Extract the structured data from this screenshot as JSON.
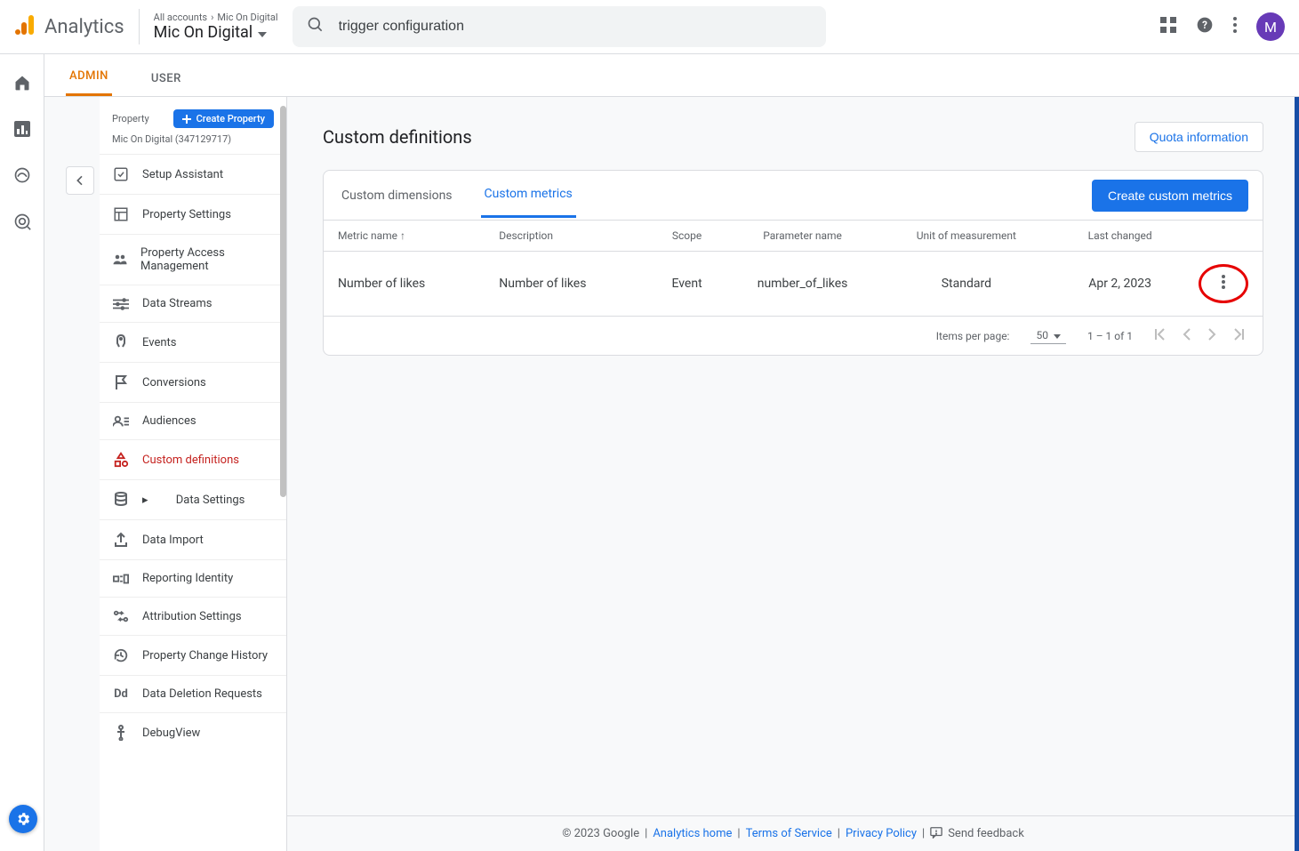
{
  "header": {
    "product": "Analytics",
    "breadcrumb_a": "All accounts",
    "breadcrumb_b": "Mic On Digital",
    "property": "Mic On Digital",
    "search_value": "trigger configuration",
    "avatar_letter": "M"
  },
  "subtabs": {
    "admin": "ADMIN",
    "user": "USER"
  },
  "sidebar": {
    "section_label": "Property",
    "create_label": "Create Property",
    "property_line": "Mic On Digital (347129717)",
    "items": [
      {
        "label": "Setup Assistant"
      },
      {
        "label": "Property Settings"
      },
      {
        "label": "Property Access Management"
      },
      {
        "label": "Data Streams"
      },
      {
        "label": "Events"
      },
      {
        "label": "Conversions"
      },
      {
        "label": "Audiences"
      },
      {
        "label": "Custom definitions"
      },
      {
        "label": "Data Settings"
      },
      {
        "label": "Data Import"
      },
      {
        "label": "Reporting Identity"
      },
      {
        "label": "Attribution Settings"
      },
      {
        "label": "Property Change History"
      },
      {
        "label": "Data Deletion Requests"
      },
      {
        "label": "DebugView"
      }
    ]
  },
  "page": {
    "title": "Custom definitions",
    "quota_btn": "Quota information",
    "tab_dimensions": "Custom dimensions",
    "tab_metrics": "Custom metrics",
    "create_btn": "Create custom metrics"
  },
  "table": {
    "cols": {
      "metric": "Metric name",
      "desc": "Description",
      "scope": "Scope",
      "param": "Parameter name",
      "unit": "Unit of measurement",
      "changed": "Last changed"
    },
    "row": {
      "metric": "Number of likes",
      "desc": "Number of likes",
      "scope": "Event",
      "param": "number_of_likes",
      "unit": "Standard",
      "changed": "Apr 2, 2023"
    }
  },
  "paginator": {
    "items_label": "Items per page:",
    "page_size": "50",
    "range": "1 – 1 of 1"
  },
  "footer": {
    "copyright": "© 2023 Google",
    "home": "Analytics home",
    "tos": "Terms of Service",
    "privacy": "Privacy Policy",
    "feedback": "Send feedback"
  }
}
